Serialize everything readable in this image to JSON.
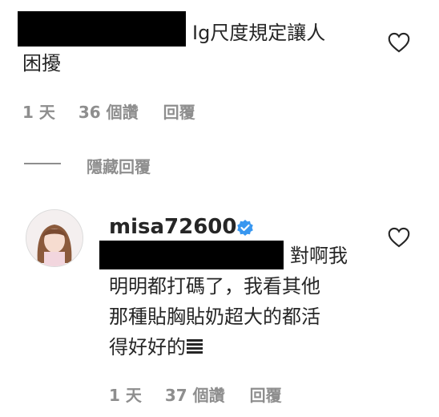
{
  "comment1": {
    "text_line1": "Ig尺度規定讓人",
    "text_line2": "困擾",
    "time": "1 天",
    "likes": "36 個讚",
    "reply": "回覆"
  },
  "hide_replies_label": "隱藏回覆",
  "reply1": {
    "username": "misa72600",
    "verified": true,
    "line1": "對啊我",
    "line2": "明明都打碼了，我看其他",
    "line3": "那種貼胸貼奶超大的都活",
    "line4": "得好好的",
    "time": "1 天",
    "likes": "37 個讚",
    "reply": "回覆"
  },
  "colors": {
    "text": "#262626",
    "secondary": "#8e8e8e",
    "verified": "#3897f0",
    "redaction": "#000000"
  },
  "icons": [
    "heart-icon",
    "verified-badge-icon",
    "avatar",
    "heart-icon"
  ]
}
